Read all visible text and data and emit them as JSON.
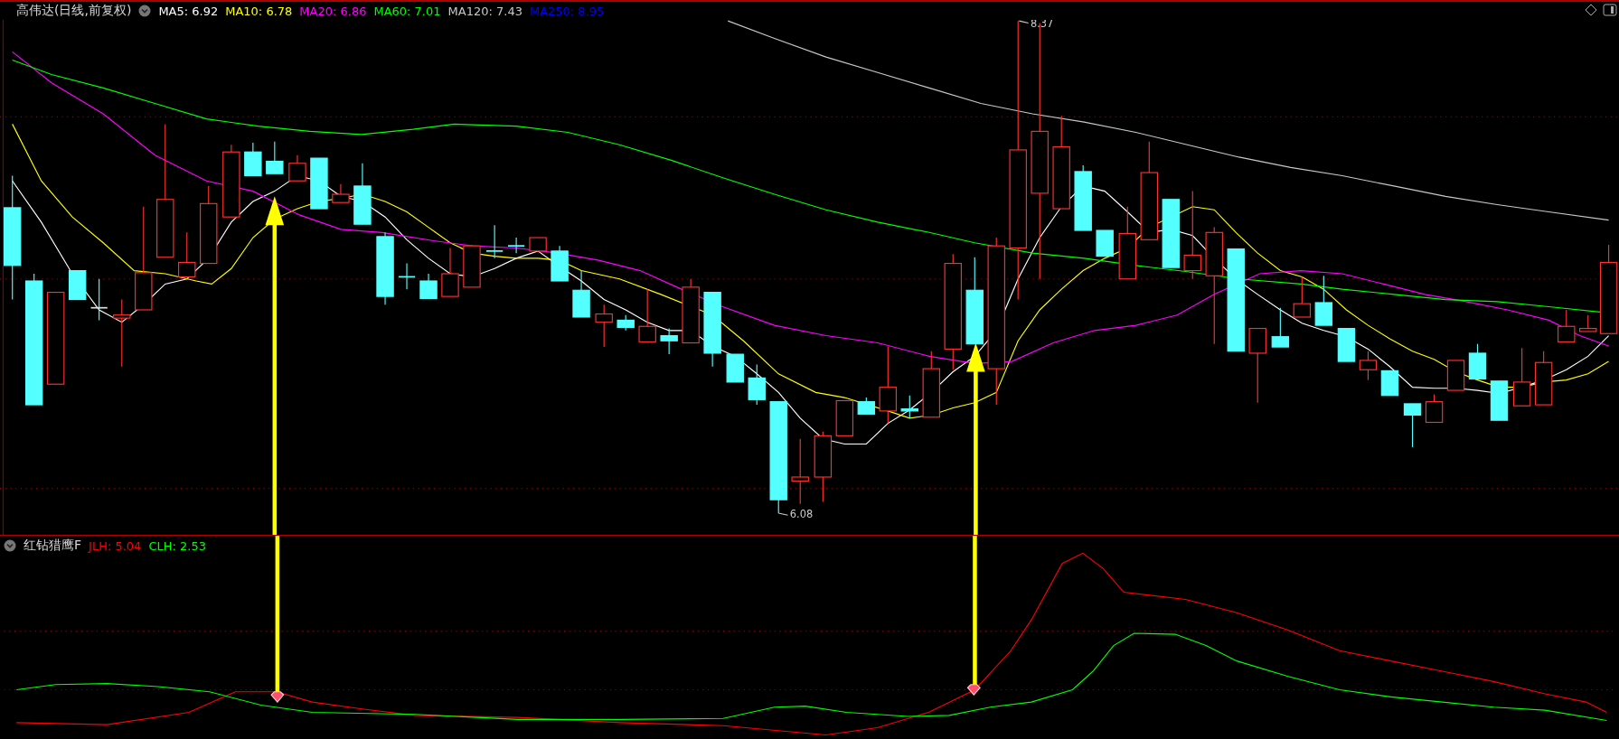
{
  "main_chart": {
    "title": "高伟达(日线,前复权)",
    "moving_averages": [
      {
        "text": "MA5: 6.92",
        "color": "#ffffff"
      },
      {
        "text": "MA10: 6.78",
        "color": "#ffff00"
      },
      {
        "text": "MA20: 6.86",
        "color": "#ff00ff"
      },
      {
        "text": "MA60: 7.01",
        "color": "#00ff00"
      },
      {
        "text": "MA120: 7.43",
        "color": "#c8c8c8"
      },
      {
        "text": "MA250: 8.95",
        "color": "#0000ff"
      }
    ],
    "price_marks": [
      {
        "kind": "high",
        "text": "8.37"
      },
      {
        "kind": "low",
        "text": "6.08"
      }
    ]
  },
  "indicator": {
    "title": "红钻猎鹰F",
    "series": [
      {
        "text": "JLH: 5.04",
        "color": "#ff0000"
      },
      {
        "text": "CLH: 2.53",
        "color": "#00ff00"
      }
    ]
  }
}
